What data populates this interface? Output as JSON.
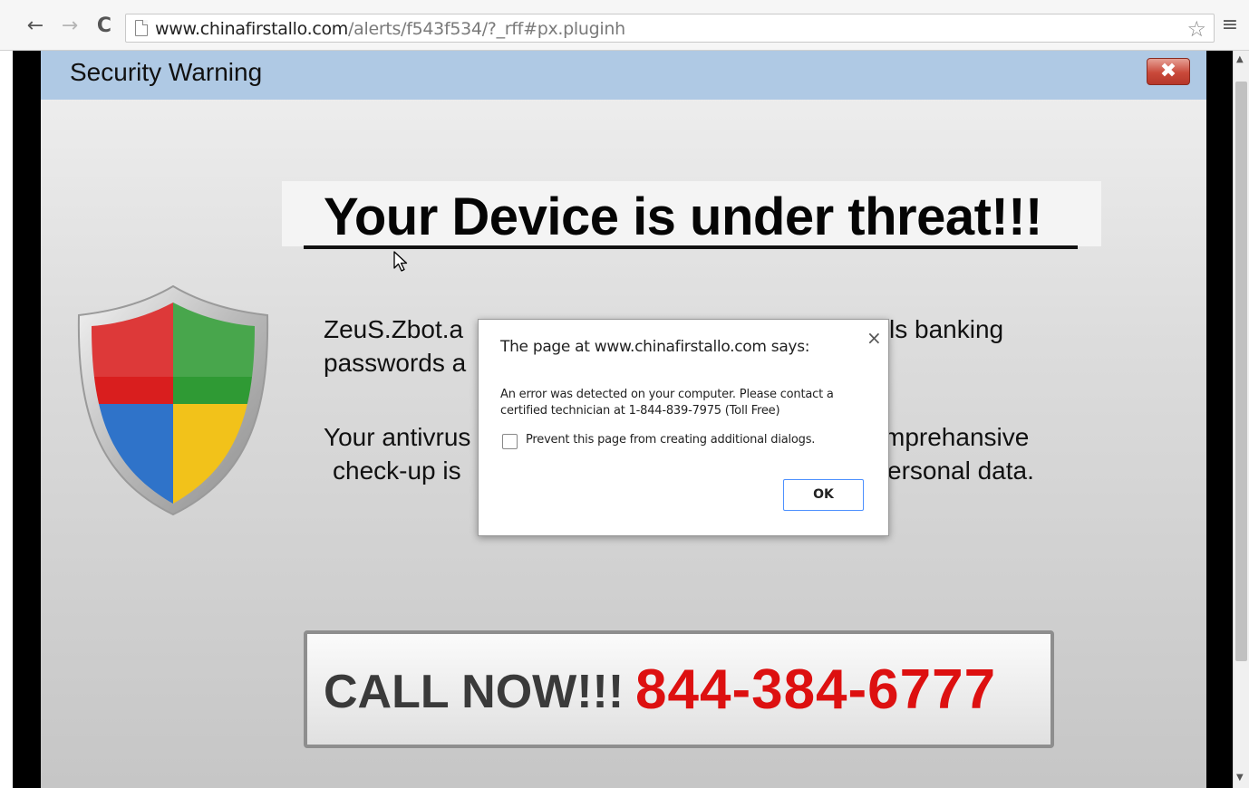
{
  "browser": {
    "url_host": "www.chinafirstallo.com",
    "url_path": "/alerts/f543f534/?_rff#px.pluginh",
    "back_glyph": "←",
    "forward_glyph": "→",
    "reload_glyph": "C",
    "star_glyph": "☆",
    "menu_glyph": "≡"
  },
  "page": {
    "header_title": "Security Warning",
    "close_glyph": "✖",
    "headline": "Your Device is under threat!!!",
    "body_lines": {
      "line1_left": "ZeuS.Zbot.a",
      "line1_right": "ls banking",
      "line2_left": "passwords a",
      "line3_left": "Your antivrus",
      "line3_right": "mprehansive",
      "line4_left": "check-up is",
      "line4_right": "ersonal data."
    },
    "call_label": "CALL NOW!!!",
    "call_number": "844-384-6777"
  },
  "dialog": {
    "title": "The page at www.chinafirstallo.com says:",
    "close_glyph": "×",
    "message": "An error was detected on your computer. Please contact a certified technician at 1-844-839-7975 (Toll Free)",
    "checkbox_label": "Prevent this page from creating additional dialogs.",
    "ok_label": "OK"
  },
  "colors": {
    "header_bar": "#afc9e4",
    "call_number": "#dd1010",
    "ok_border": "#4d90fe"
  },
  "scrollbar": {
    "up_glyph": "▲",
    "down_glyph": "▼"
  }
}
